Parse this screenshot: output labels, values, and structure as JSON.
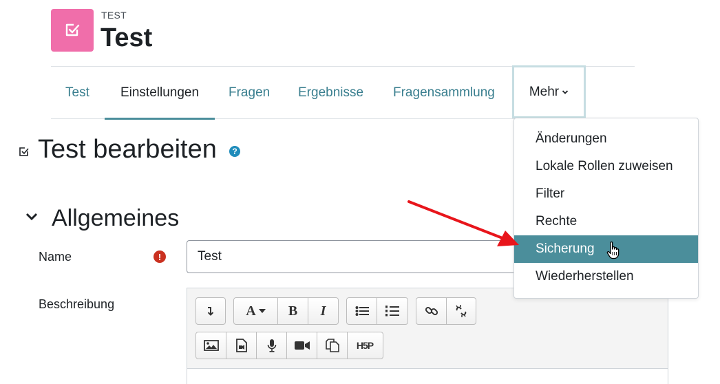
{
  "header": {
    "activity_type": "TEST",
    "activity_title": "Test",
    "icon": "checkbox-icon",
    "icon_bg": "#f06eaa"
  },
  "nav": {
    "tabs": [
      {
        "label": "Test"
      },
      {
        "label": "Einstellungen",
        "active": true
      },
      {
        "label": "Fragen"
      },
      {
        "label": "Ergebnisse"
      },
      {
        "label": "Fragensammlung"
      }
    ],
    "more_label": "Mehr",
    "accent": "#4b8e9b"
  },
  "dropdown": {
    "items": [
      {
        "label": "Änderungen"
      },
      {
        "label": "Lokale Rollen zuweisen"
      },
      {
        "label": "Filter"
      },
      {
        "label": "Rechte"
      },
      {
        "label": "Sicherung",
        "highlighted": true
      },
      {
        "label": "Wiederherstellen"
      }
    ],
    "highlight_color": "#4b8e9b"
  },
  "main": {
    "heading": "Test bearbeiten",
    "help_glyph": "?",
    "section_title": "Allgemeines",
    "name_label": "Name",
    "required_glyph": "!",
    "name_value": "Test",
    "description_label": "Beschreibung"
  },
  "editor": {
    "toolbar_row1": [
      "collapse-icon",
      "font-color-icon",
      "bold-icon",
      "italic-icon",
      "unordered-list-icon",
      "ordered-list-icon",
      "link-icon",
      "unlink-icon"
    ],
    "toolbar_row2": [
      "image-icon",
      "media-icon",
      "microphone-icon",
      "video-icon",
      "manage-files-icon",
      "h5p-icon"
    ],
    "bold_glyph": "B",
    "italic_glyph": "I",
    "font_glyph": "A",
    "h5p_glyph": "H5P"
  },
  "annotation": {
    "arrow_color": "#e8151b"
  }
}
